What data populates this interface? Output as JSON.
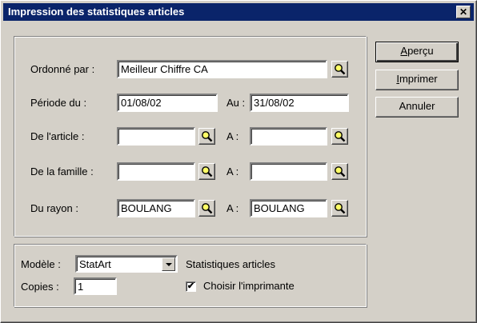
{
  "window": {
    "title": "Impression des statistiques articles",
    "close_glyph": "✕"
  },
  "buttons": {
    "preview": {
      "first": "A",
      "rest": "perçu"
    },
    "print": {
      "first": "I",
      "rest": "mprimer"
    },
    "cancel": "Annuler"
  },
  "criteria": {
    "ordered_by": {
      "label": "Ordonné par :",
      "value": "Meilleur Chiffre CA"
    },
    "period": {
      "label": "Période du :",
      "from": "01/08/02",
      "to_label": "Au :",
      "to": "31/08/02"
    },
    "article": {
      "label": "De l'article :",
      "from": "",
      "to_label": "A :",
      "to": ""
    },
    "family": {
      "label": "De la famille :",
      "from": "",
      "to_label": "A :",
      "to": ""
    },
    "department": {
      "label": "Du rayon :",
      "from": "BOULANG",
      "to_label": "A :",
      "to": "BOULANG"
    }
  },
  "output": {
    "model_label": "Modèle :",
    "model_value": "StatArt",
    "model_description": "Statistiques articles",
    "copies_label": "Copies :",
    "copies_value": "1",
    "choose_printer_label": "Choisir l'imprimante",
    "choose_printer_checked": true,
    "check_glyph": "✔"
  },
  "icons": {
    "lookup": "magnifier-icon",
    "dropdown": "chevron-down-icon",
    "close": "close-icon"
  }
}
